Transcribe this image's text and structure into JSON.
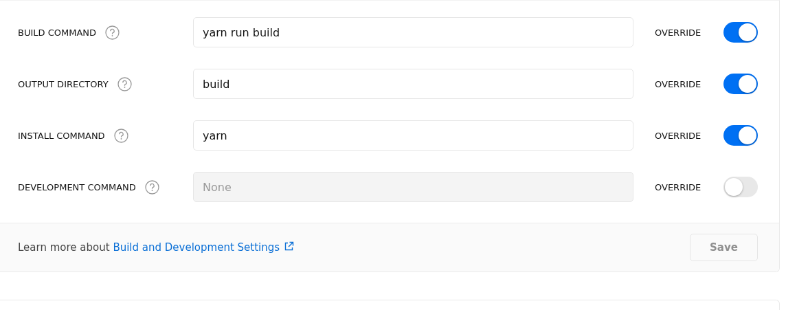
{
  "settings": [
    {
      "label": "BUILD COMMAND",
      "value": "yarn run build",
      "disabled": false,
      "override_label": "OVERRIDE",
      "on": true
    },
    {
      "label": "OUTPUT DIRECTORY",
      "value": "build",
      "disabled": false,
      "override_label": "OVERRIDE",
      "on": true
    },
    {
      "label": "INSTALL COMMAND",
      "value": "yarn",
      "disabled": false,
      "override_label": "OVERRIDE",
      "on": true
    },
    {
      "label": "DEVELOPMENT COMMAND",
      "placeholder": "None",
      "disabled": true,
      "override_label": "OVERRIDE",
      "on": false
    }
  ],
  "footer": {
    "text": "Learn more about",
    "link": "Build and Development Settings",
    "save": {
      "label": "Save",
      "disabled": true
    }
  }
}
